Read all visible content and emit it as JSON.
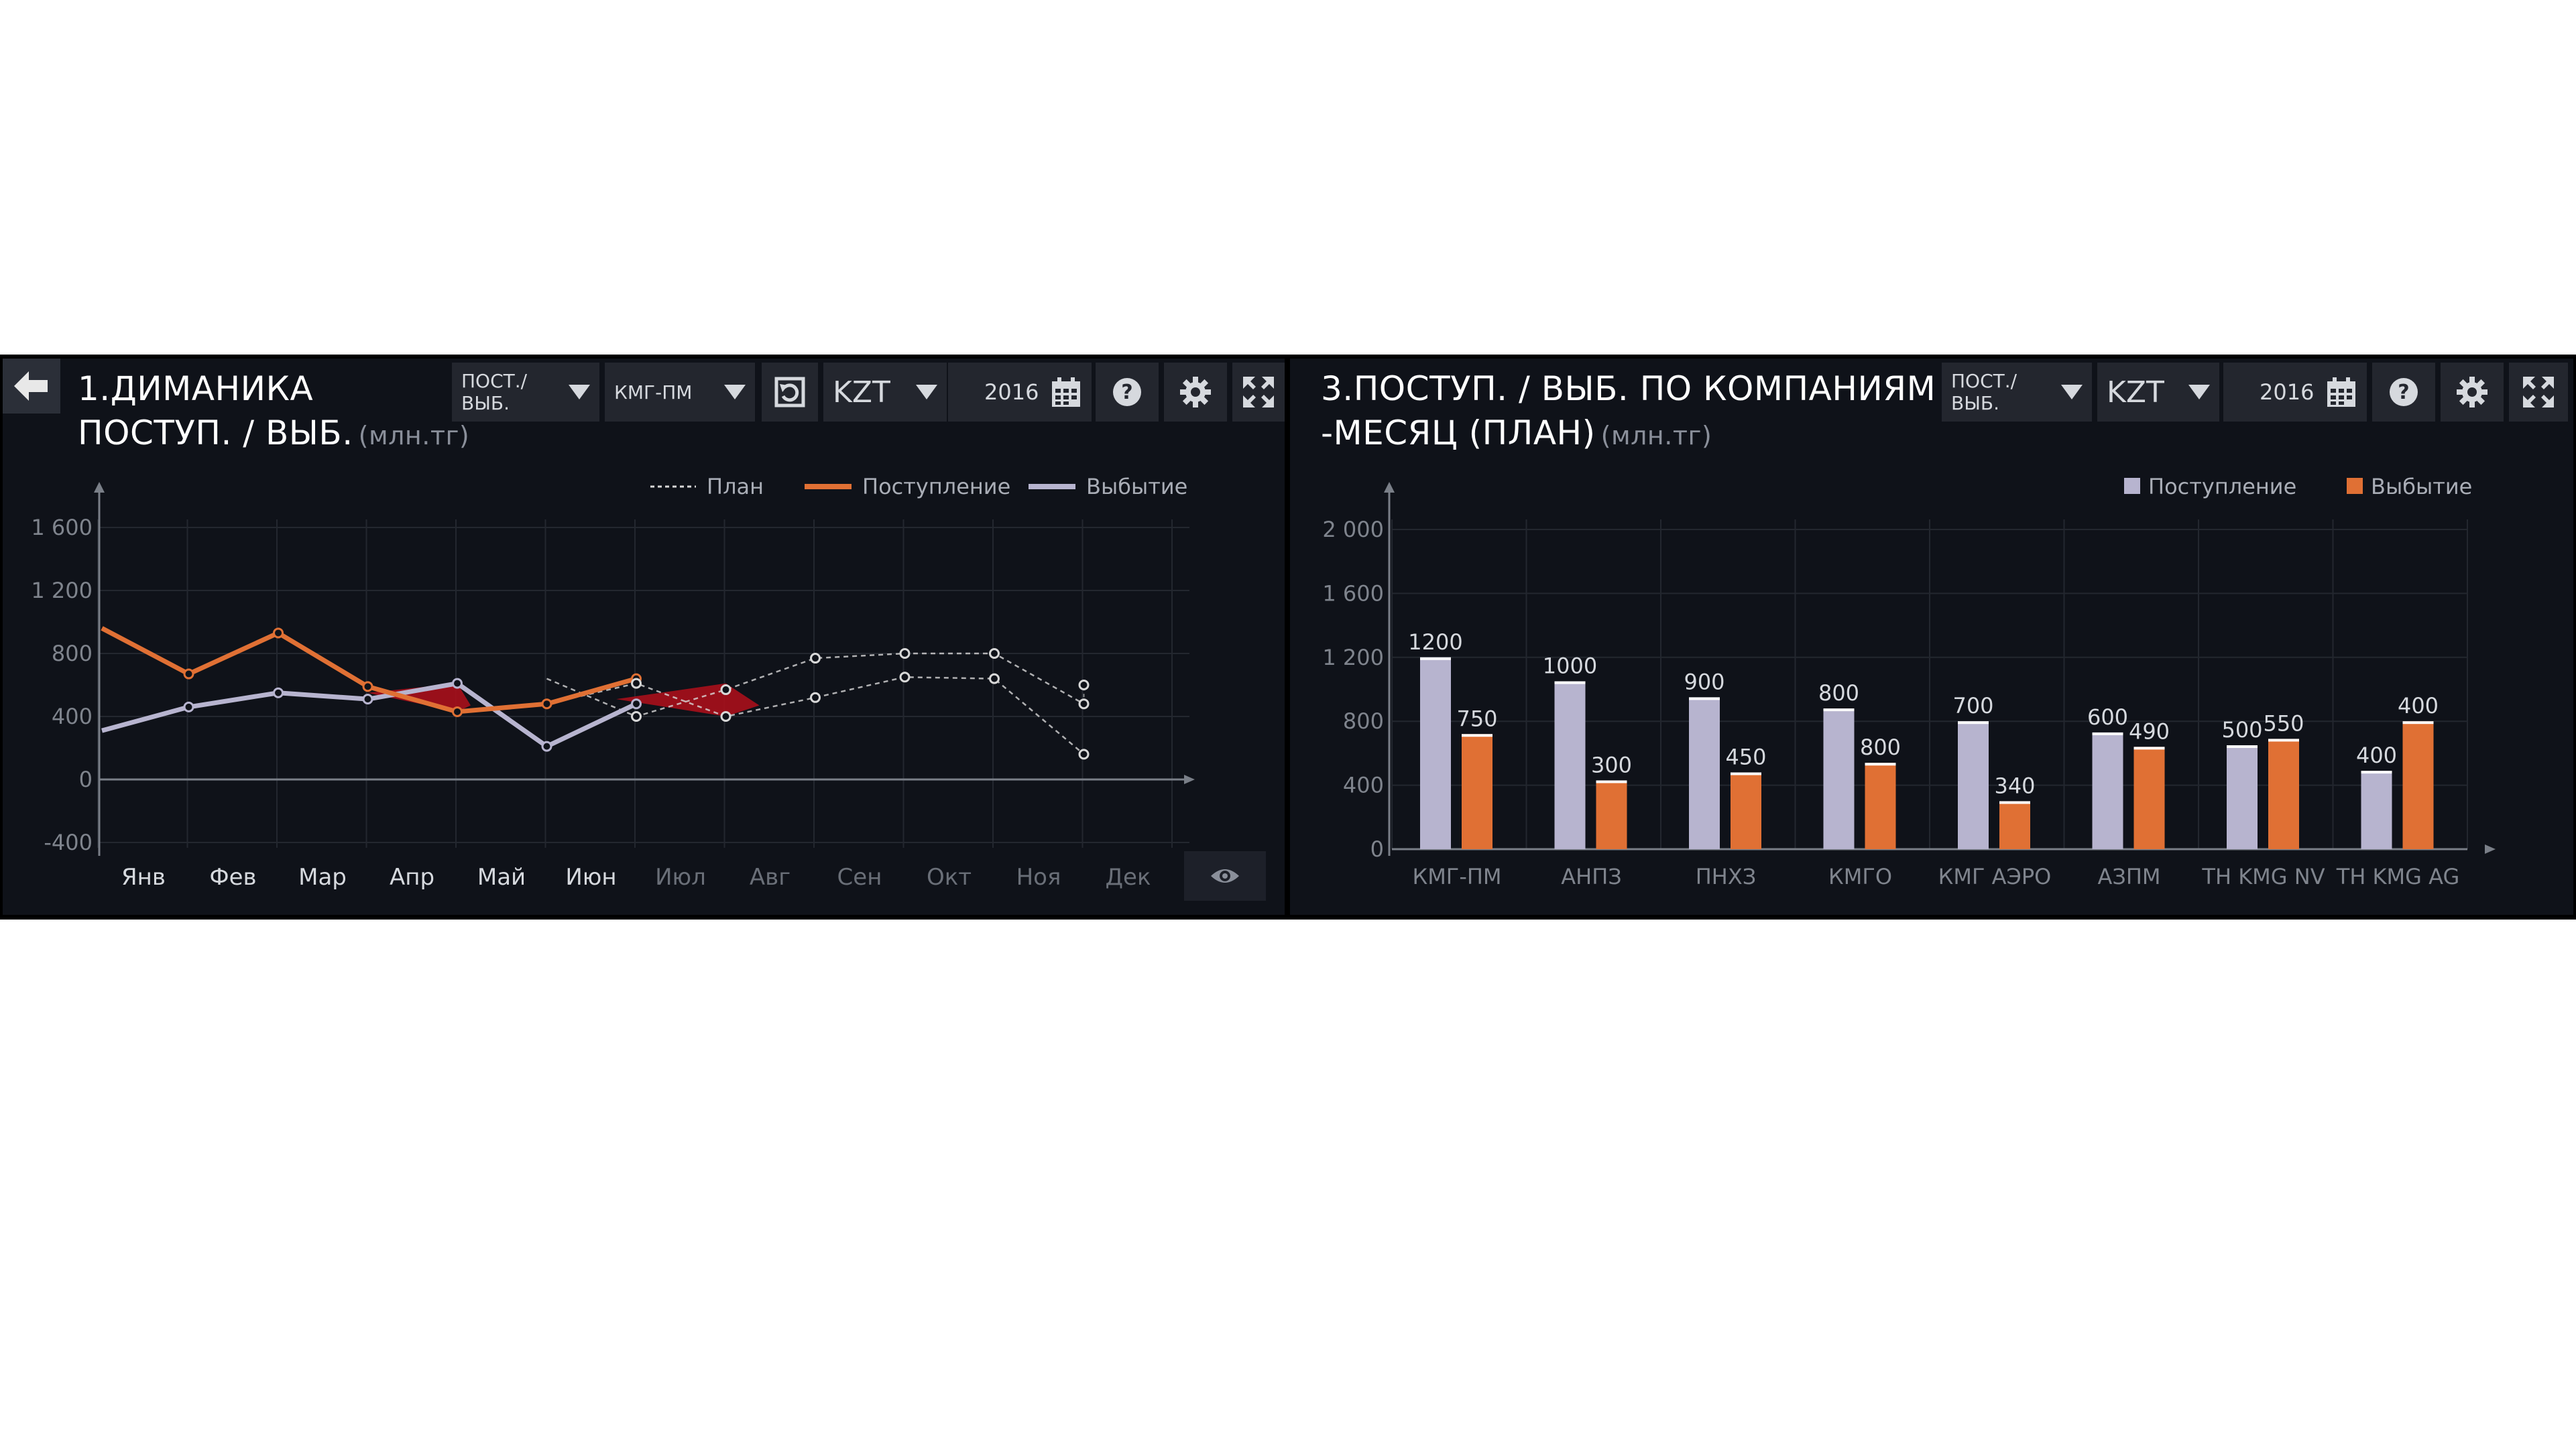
{
  "colors": {
    "inflow": "#e07034",
    "outflow": "#b7b4cf",
    "plan": "#d8d8d8",
    "gap": "#a8101b",
    "panel_bg": "#0f1219",
    "control_bg": "#23262e"
  },
  "panel1": {
    "title_line1": "1.ДИМАНИКА",
    "title_line2": "ПОСТУП. / ВЫБ.",
    "unit": "(млн.тг)",
    "controls": {
      "type_select": "ПОСТ./ВЫБ.",
      "company_select": "КМГ-ПМ",
      "currency_select": "KZT",
      "year": "2016"
    },
    "icons": [
      "back-arrow-icon",
      "refresh-icon",
      "calendar-icon",
      "help-icon",
      "gear-icon",
      "expand-icon",
      "eye-icon"
    ],
    "legend": {
      "plan": "План",
      "inflow": "Поступление",
      "outflow": "Выбытие"
    }
  },
  "panel2": {
    "title_line1": "3.ПОСТУП. / ВЫБ. ПО КОМПАНИЯМ -",
    "title_line2": "-МЕСЯЦ (ПЛАН)",
    "unit": "(млн.тг)",
    "controls": {
      "type_select": "ПОСТ./ВЫБ.",
      "currency_select": "KZT",
      "year": "2016"
    },
    "icons": [
      "calendar-icon",
      "help-icon",
      "gear-icon",
      "expand-icon"
    ],
    "legend": {
      "inflow": "Поступление",
      "outflow": "Выбытие"
    }
  },
  "chart_data": [
    {
      "type": "line",
      "categories": [
        "Янв",
        "Фев",
        "Мар",
        "Апр",
        "Май",
        "Июн",
        "Июл",
        "Авг",
        "Сен",
        "Окт",
        "Ноя",
        "Дек"
      ],
      "actual_months": 6,
      "series": [
        {
          "name": "Поступление",
          "values": [
            960,
            670,
            930,
            590,
            430,
            480,
            640
          ]
        },
        {
          "name": "Выбытие",
          "values": [
            310,
            460,
            550,
            510,
            610,
            210,
            480
          ]
        },
        {
          "name": "План",
          "values": [
            null,
            null,
            null,
            null,
            null,
            640,
            400,
            570,
            770,
            800,
            800,
            480
          ]
        },
        {
          "name": "План",
          "values": [
            null,
            null,
            null,
            null,
            null,
            480,
            610,
            400,
            520,
            650,
            640,
            160
          ]
        }
      ],
      "plan_end_extra": 600,
      "yticks": [
        "1 600",
        "1 200",
        "800",
        "400",
        "0",
        "-400"
      ],
      "ylim": [
        -400,
        1600
      ],
      "grid": true,
      "legend_position": "top-right"
    },
    {
      "type": "bar",
      "categories": [
        "КМГ-ПМ",
        "АНПЗ",
        "ПНХЗ",
        "КМГО",
        "КМГ АЭРО",
        "АЗПМ",
        "TH KMG NV",
        "TH KMG AG"
      ],
      "series": [
        {
          "name": "Поступление",
          "values": [
            1200,
            1000,
            900,
            800,
            700,
            600,
            500,
            400
          ],
          "bar_heights": [
            1200,
            1050,
            950,
            880,
            800,
            730,
            650,
            490
          ]
        },
        {
          "name": "Выбытие",
          "values": [
            750,
            300,
            450,
            800,
            340,
            490,
            550,
            400
          ],
          "bar_heights": [
            720,
            430,
            480,
            540,
            300,
            640,
            690,
            800
          ]
        }
      ],
      "yticks": [
        "2 000",
        "1 600",
        "1 200",
        "800",
        "400",
        "0"
      ],
      "ylim": [
        0,
        2000
      ],
      "grid": true,
      "legend_position": "top-right"
    }
  ]
}
